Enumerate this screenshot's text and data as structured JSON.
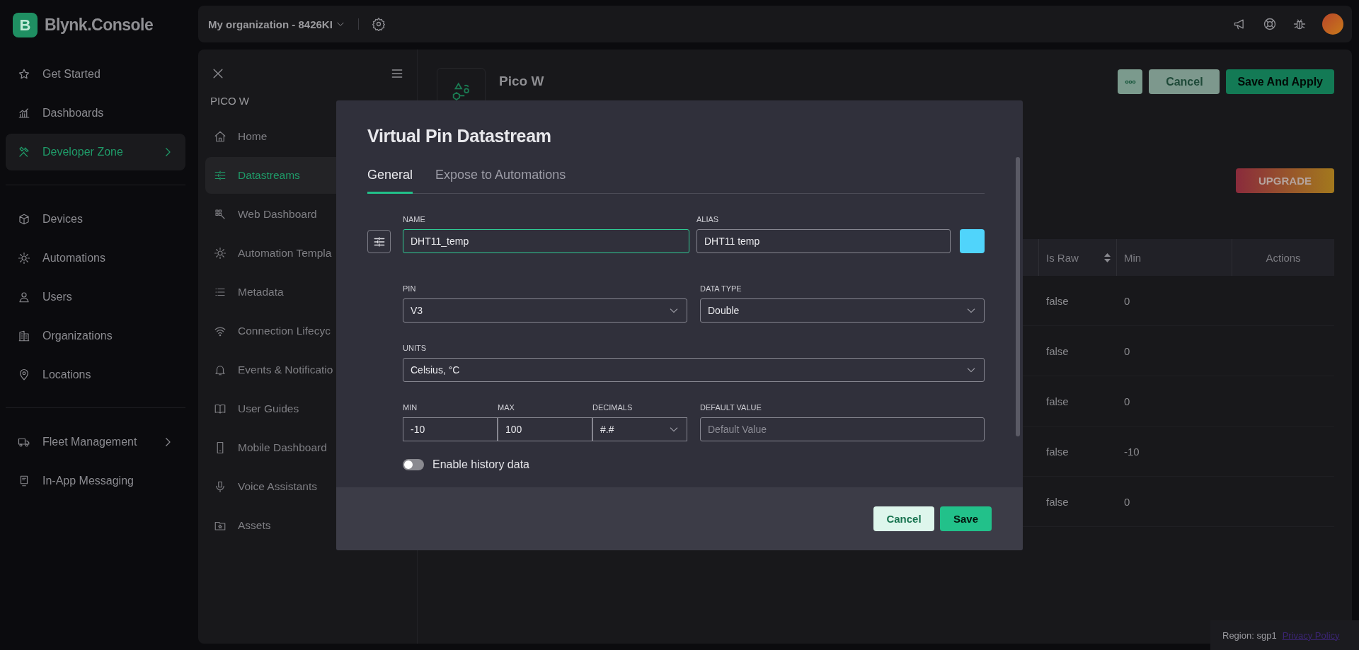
{
  "brand": {
    "logo_letter": "B",
    "name": "Blynk.Console"
  },
  "sidebar": {
    "groups": [
      {
        "items": [
          {
            "label": "Get Started",
            "selected": false,
            "has_submenu": false
          },
          {
            "label": "Dashboards",
            "selected": false,
            "has_submenu": false
          },
          {
            "label": "Developer Zone",
            "selected": true,
            "has_submenu": true
          }
        ]
      },
      {
        "items": [
          {
            "label": "Devices",
            "selected": false,
            "has_submenu": false
          },
          {
            "label": "Automations",
            "selected": false,
            "has_submenu": false
          },
          {
            "label": "Users",
            "selected": false,
            "has_submenu": false
          },
          {
            "label": "Organizations",
            "selected": false,
            "has_submenu": false
          },
          {
            "label": "Locations",
            "selected": false,
            "has_submenu": false
          }
        ]
      },
      {
        "items": [
          {
            "label": "Fleet Management",
            "selected": false,
            "has_submenu": true
          },
          {
            "label": "In-App Messaging",
            "selected": false,
            "has_submenu": false
          }
        ]
      }
    ]
  },
  "top_bar": {
    "organization": "My organization - 8426KI"
  },
  "sub_nav": {
    "title": "PICO W",
    "items": [
      {
        "label": "Home",
        "selected": false
      },
      {
        "label": "Datastreams",
        "selected": true
      },
      {
        "label": "Web Dashboard",
        "selected": false
      },
      {
        "label": "Automation Templa",
        "selected": false
      },
      {
        "label": "Metadata",
        "selected": false
      },
      {
        "label": "Connection Lifecyc",
        "selected": false
      },
      {
        "label": "Events & Notificatio",
        "selected": false
      },
      {
        "label": "User Guides",
        "selected": false
      },
      {
        "label": "Mobile Dashboard",
        "selected": false
      },
      {
        "label": "Voice Assistants",
        "selected": false
      },
      {
        "label": "Assets",
        "selected": false
      }
    ]
  },
  "product": {
    "name": "Pico W",
    "cancel": "Cancel",
    "save": "Save And Apply",
    "upgrade": "UPGRADE"
  },
  "table": {
    "columns": [
      {
        "label": "Is Raw",
        "sortable": true
      },
      {
        "label": "Min",
        "sortable": false
      },
      {
        "label": "Actions",
        "sortable": false
      }
    ],
    "rows": [
      [
        "false",
        "0"
      ],
      [
        "false",
        "0"
      ],
      [
        "false",
        "0"
      ],
      [
        "false",
        "-10"
      ],
      [
        "false",
        "0"
      ]
    ]
  },
  "modal": {
    "title": "Virtual Pin Datastream",
    "tabs": [
      {
        "label": "General",
        "selected": true
      },
      {
        "label": "Expose to Automations",
        "selected": false
      }
    ],
    "name": {
      "label": "NAME",
      "value": "DHT11_temp",
      "focused": true
    },
    "alias": {
      "label": "ALIAS",
      "value": "DHT11 temp",
      "focused": false
    },
    "swatch": {
      "color": "#50d4fb"
    },
    "pin": {
      "label": "PIN",
      "value": "V3"
    },
    "data_type": {
      "label": "DATA TYPE",
      "value": "Double"
    },
    "units": {
      "label": "UNITS",
      "value": "Celsius, °C"
    },
    "min": {
      "label": "MIN",
      "value": "-10"
    },
    "max": {
      "label": "MAX",
      "value": "100"
    },
    "decimals": {
      "label": "DECIMALS",
      "value": "#.#"
    },
    "default_value": {
      "label": "DEFAULT VALUE",
      "placeholder": "Default Value"
    },
    "history": {
      "label": "Enable history data",
      "on": false
    },
    "cancel": "Cancel",
    "save": "Save"
  },
  "footer": {
    "region": "Region: sgp1",
    "link": "Privacy Policy"
  }
}
